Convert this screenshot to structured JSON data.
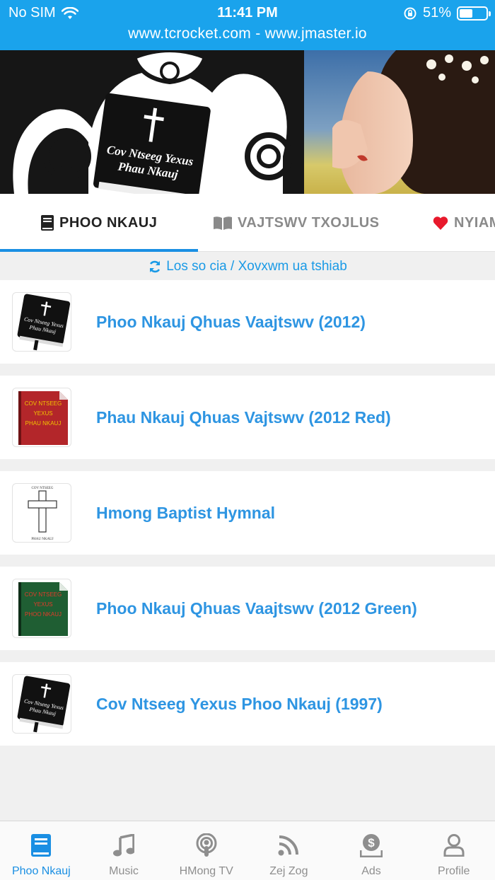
{
  "status_bar": {
    "carrier": "No SIM",
    "time": "11:41 PM",
    "battery_percent": "51%",
    "battery_level": 0.51
  },
  "url_bar": {
    "text": "www.tcrocket.com - www.jmaster.io"
  },
  "banner": {
    "book_line1": "Cov Ntseeg Yexus",
    "book_line2": "Phau Nkauj"
  },
  "tabs": [
    {
      "label": "PHOO NKAUJ",
      "icon": "book-icon",
      "active": true
    },
    {
      "label": "VAJTSWV TXOJLUS",
      "icon": "open-book-icon",
      "active": false
    },
    {
      "label": "NYIAM",
      "icon": "heart-icon",
      "active": false
    }
  ],
  "refresh": {
    "label": "Los so cia / Xovxwm ua tshiab"
  },
  "list": [
    {
      "title": "Phoo Nkauj Qhuas Vaajtswv (2012)",
      "thumb_line1": "Cov Ntseeg Yexus",
      "thumb_line2": "Phau Nkauj"
    },
    {
      "title": "Phau Nkauj Qhuas Vajtswv (2012 Red)",
      "thumb_line1": "COV NTSEEG",
      "thumb_line2": "YEXUS",
      "thumb_line3": "PHAU NKAUJ"
    },
    {
      "title": "Hmong Baptist Hymnal",
      "thumb_line1": "COV NTSEEG",
      "thumb_line2": "PHAU NKAUJ"
    },
    {
      "title": "Phoo Nkauj Qhuas Vaajtswv (2012 Green)",
      "thumb_line1": "COV NTSEEG",
      "thumb_line2": "YEXUS",
      "thumb_line3": "PHOO NKAUJ"
    },
    {
      "title": "Cov Ntseeg Yexus Phoo Nkauj (1997)",
      "thumb_line1": "Cov Ntseeg Yexus",
      "thumb_line2": "Phau Nkauj"
    }
  ],
  "bottom_nav": [
    {
      "label": "Phoo Nkauj",
      "icon": "book-icon",
      "active": true
    },
    {
      "label": "Music",
      "icon": "music-note-icon",
      "active": false
    },
    {
      "label": "HMong TV",
      "icon": "podcast-icon",
      "active": false
    },
    {
      "label": "Zej Zog",
      "icon": "rss-icon",
      "active": false
    },
    {
      "label": "Ads",
      "icon": "dollar-icon",
      "active": false
    },
    {
      "label": "Profile",
      "icon": "user-icon",
      "active": false
    }
  ],
  "colors": {
    "accent": "#1a8fe3",
    "top_bar": "#1aa3ec",
    "title_text": "#2e95e2"
  }
}
